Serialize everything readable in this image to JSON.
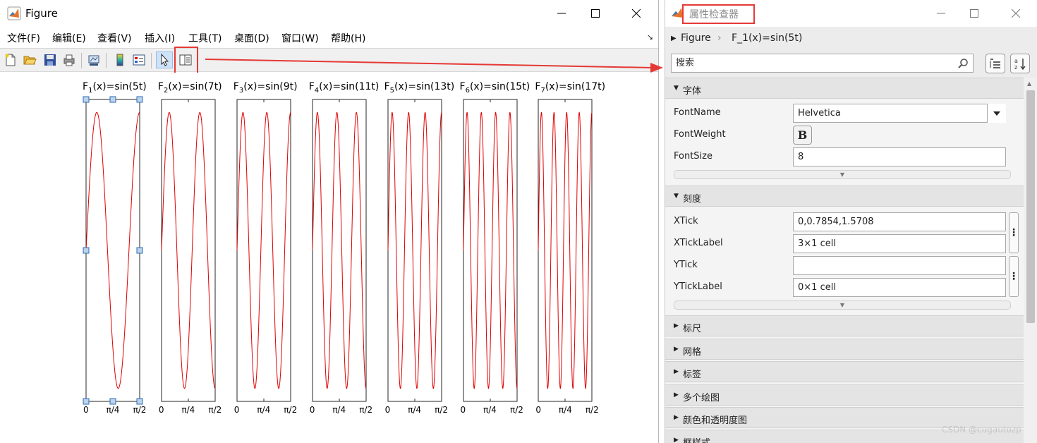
{
  "figure": {
    "title": "Figure",
    "menu": [
      "文件(F)",
      "编辑(E)",
      "查看(V)",
      "插入(I)",
      "工具(T)",
      "桌面(D)",
      "窗口(W)",
      "帮助(H)"
    ],
    "plots": [
      {
        "base": "F",
        "sub": "1",
        "rest": "(x)=sin(5t)",
        "freq": 5
      },
      {
        "base": "F",
        "sub": "2",
        "rest": "(x)=sin(7t)",
        "freq": 7
      },
      {
        "base": "F",
        "sub": "3",
        "rest": "(x)=sin(9t)",
        "freq": 9
      },
      {
        "base": "F",
        "sub": "4",
        "rest": "(x)=sin(11t)",
        "freq": 11
      },
      {
        "base": "F",
        "sub": "5",
        "rest": "(x)=sin(13t)",
        "freq": 13
      },
      {
        "base": "F",
        "sub": "6",
        "rest": "(x)=sin(15t)",
        "freq": 15
      },
      {
        "base": "F",
        "sub": "7",
        "rest": "(x)=sin(17t)",
        "freq": 17
      }
    ],
    "xtick_labels": [
      "0",
      "π/4",
      "π/2"
    ],
    "line_color": "#e00000",
    "selected_plot": 1
  },
  "inspector": {
    "title": "属性检查器",
    "breadcrumb": {
      "root": "Figure",
      "child": "F_1(x)=sin(5t)"
    },
    "search_placeholder": "搜索",
    "sections": {
      "font": "字体",
      "ticks": "刻度",
      "collapsed": [
        "标尺",
        "网格",
        "标签",
        "多个绘图",
        "颜色和透明度图",
        "框样式"
      ]
    },
    "props": {
      "FontName": {
        "label": "FontName",
        "value": "Helvetica"
      },
      "FontWeight": {
        "label": "FontWeight",
        "value": "B"
      },
      "FontSize": {
        "label": "FontSize",
        "value": "8"
      },
      "XTick": {
        "label": "XTick",
        "value": "0,0.7854,1.5708"
      },
      "XTickLabel": {
        "label": "XTickLabel",
        "value": "3×1 cell"
      },
      "YTick": {
        "label": "YTick",
        "value": ""
      },
      "YTickLabel": {
        "label": "YTickLabel",
        "value": "0×1 cell"
      }
    },
    "highlight_color": "#e53935"
  },
  "watermark": "CSDN @cugautozp"
}
